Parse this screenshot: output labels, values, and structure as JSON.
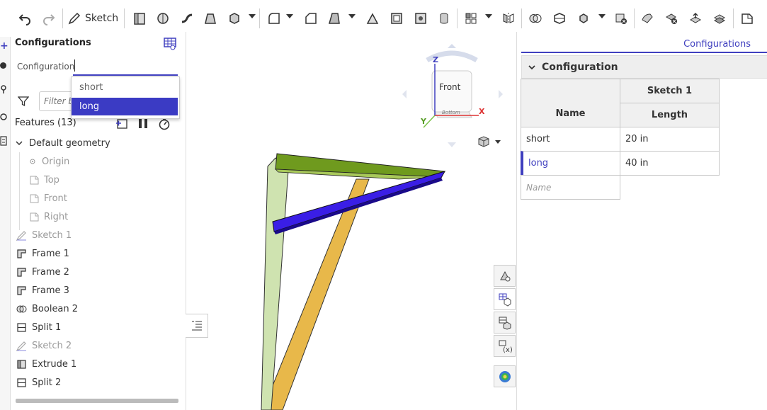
{
  "toolbar": {
    "sketch_label": "Sketch"
  },
  "panel": {
    "title": "Configurations",
    "config_label": "Configuration",
    "config_input_value": "",
    "dropdown_options": [
      "short",
      "long"
    ],
    "dropdown_selected": "long",
    "filter_placeholder": "Filter b",
    "features_label": "Features (13)",
    "default_geometry": "Default geometry",
    "geometry_items": [
      "Origin",
      "Top",
      "Front",
      "Right"
    ],
    "features": [
      {
        "label": "Sketch 1",
        "icon": "sketch-icon",
        "muted": true
      },
      {
        "label": "Frame 1",
        "icon": "frame-icon",
        "muted": false
      },
      {
        "label": "Frame 2",
        "icon": "frame-icon",
        "muted": false
      },
      {
        "label": "Frame 3",
        "icon": "frame-icon",
        "muted": false
      },
      {
        "label": "Boolean 2",
        "icon": "boolean-icon",
        "muted": false
      },
      {
        "label": "Split 1",
        "icon": "split-icon",
        "muted": false
      },
      {
        "label": "Sketch 2",
        "icon": "sketch-icon",
        "muted": true
      },
      {
        "label": "Extrude 1",
        "icon": "extrude-icon",
        "muted": false
      },
      {
        "label": "Split 2",
        "icon": "split-icon",
        "muted": false
      }
    ]
  },
  "viewcube": {
    "face_label": "Front",
    "bottom_label": "Bottom",
    "axis_x": "X",
    "axis_y": "Y",
    "axis_z": "Z"
  },
  "right": {
    "tab_label": "Configurations",
    "section_title": "Configuration",
    "table": {
      "group_header": "Sketch 1",
      "col_name": "Name",
      "col_length": "Length",
      "rows": [
        {
          "name": "short",
          "length": "20 in",
          "active": false
        },
        {
          "name": "long",
          "length": "40 in",
          "active": true
        }
      ],
      "new_row_placeholder": "Name"
    }
  },
  "colors": {
    "accent": "#3f3fbf",
    "selected_bg": "#3b3bc4",
    "beam_purple": "#3a1ee6",
    "beam_green": "#6f9a1e",
    "beam_yellow": "#e8b84a"
  }
}
